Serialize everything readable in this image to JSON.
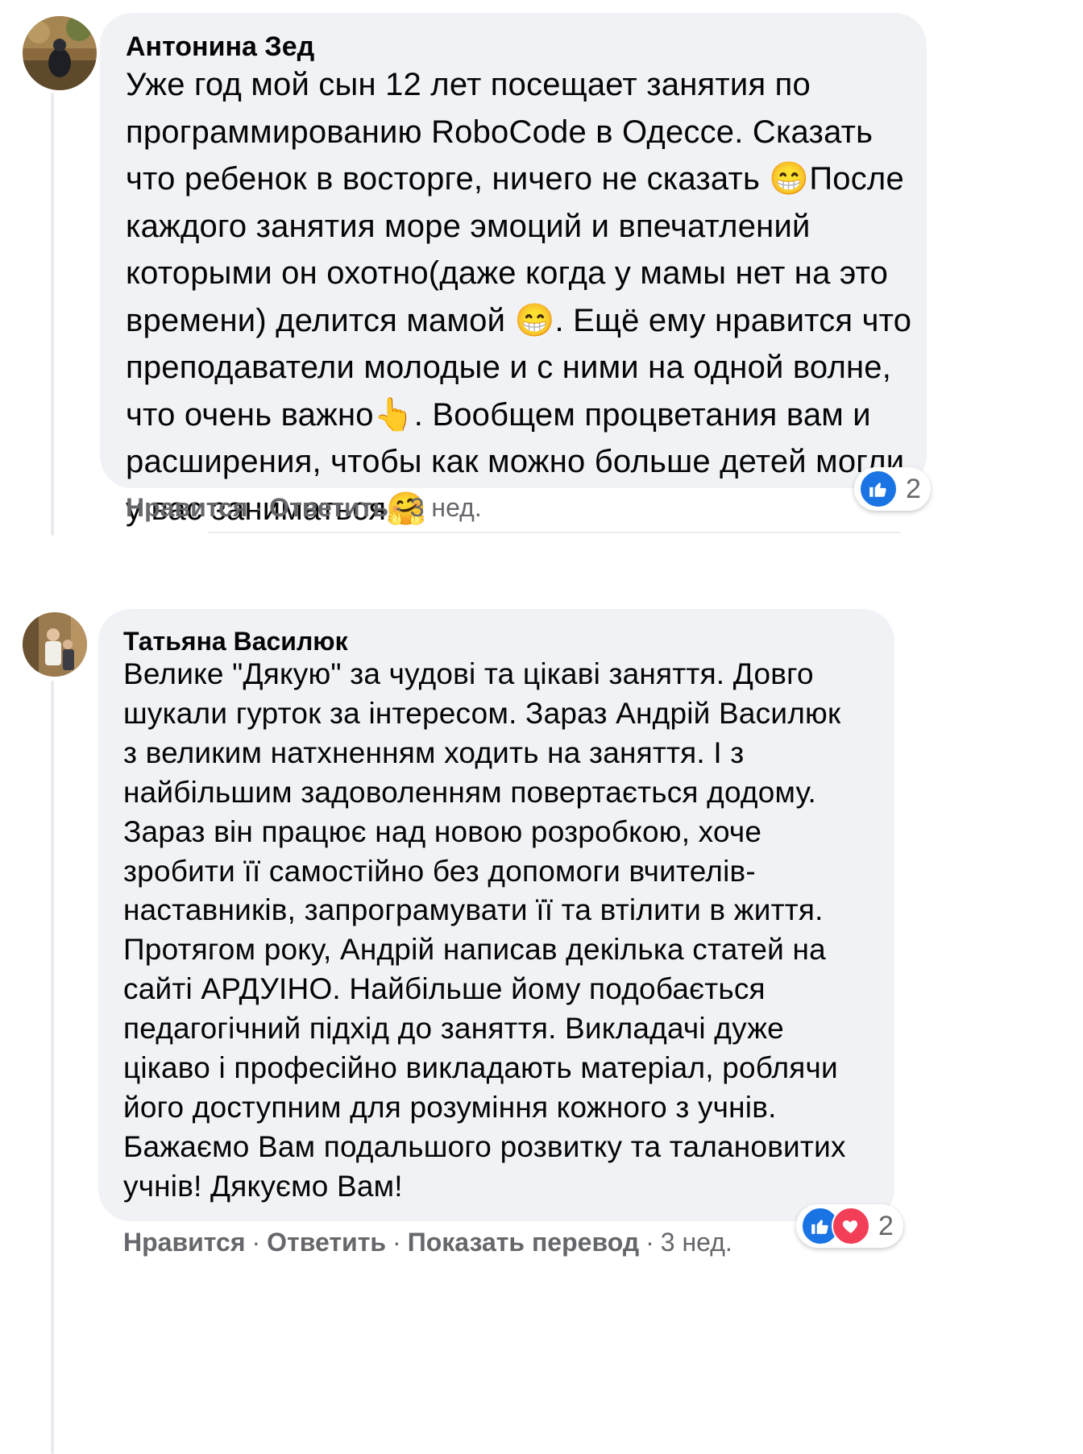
{
  "comments": [
    {
      "author": "Антонина Зед",
      "text": "Уже год мой сын 12 лет посещает занятия по\nпрограммированию RoboCode в Одессе. Сказать\nчто ребенок в восторге, ничего не сказать 😁После\nкаждого занятия море эмоций и впечатлений\nкоторыми он охотно(даже когда у мамы нет на это\nвремени) делится мамой 😁. Ещё ему нравится что\nпреподаватели молодые и с ними на одной волне,\nчто очень важно👆. Вообщем процветания вам и\nрасширения, чтобы как можно больше детей могли\nу вас заниматься🤗",
      "actions": {
        "like": "Нравится",
        "reply": "Ответить"
      },
      "time": "3 нед.",
      "reaction_count": "2",
      "reaction_icons": [
        "like-reaction-icon"
      ]
    },
    {
      "author": "Татьяна Василюк",
      "text": "Велике \"Дякую\" за чудові та цікаві заняття. Довго\nшукали гурток за інтересом. Зараз Андрій Василюк\nз великим натхненням ходить на заняття. І з\nнайбільшим задоволенням повертається додому.\nЗараз він працює над новою розробкою, хоче\nзробити її самостійно без допомоги вчителів-\nнаставників, запрограмувати її та втілити в життя.\nПротягом року, Андрій написав декілька статей на\nсайті АРДУІНО. Найбільше йому подобається\nпедагогічний підхід до заняття. Викладачі дуже\nцікаво і професійно викладають матеріал, роблячи\nйого доступним для розуміння кожного з учнів.\nБажаємо Вам подальшого розвитку та талановитих\nучнів! Дякуємо Вам!",
      "actions": {
        "like": "Нравится",
        "reply": "Ответить",
        "translate": "Показать перевод"
      },
      "time": "3 нед.",
      "reaction_count": "2",
      "reaction_icons": [
        "like-reaction-icon",
        "love-reaction-icon"
      ]
    }
  ],
  "colors": {
    "bubble": "#f0f2f5",
    "meta": "#65676b",
    "like_blue": "#1b74e4",
    "love_red": "#f33e58"
  }
}
